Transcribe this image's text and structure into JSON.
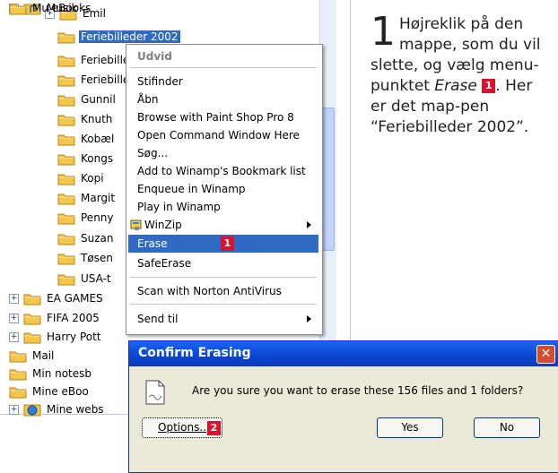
{
  "tree": {
    "items": [
      {
        "label": "Emil",
        "expander": "+"
      },
      {
        "label": "Feriebilleder 2002",
        "selected": true
      },
      {
        "label": "Feriebilleder"
      },
      {
        "label": "Feriebilleder"
      },
      {
        "label": "Gunnil"
      },
      {
        "label": "Knuth"
      },
      {
        "label": "Kobæl"
      },
      {
        "label": "Kongs"
      },
      {
        "label": "Kopi"
      },
      {
        "label": "Margit"
      },
      {
        "label": "Penny"
      },
      {
        "label": "Suzan"
      },
      {
        "label": "Tøsen"
      },
      {
        "label": "USA-t"
      },
      {
        "label": "EA GAMES",
        "expander": "+"
      },
      {
        "label": "FIFA 2005",
        "expander": "+"
      },
      {
        "label": "Harry Pott",
        "expander": "+"
      },
      {
        "label": "Mail"
      },
      {
        "label": "Min notesb"
      },
      {
        "label": "Mine eBoo"
      },
      {
        "label": "Mine webs",
        "expander": "+",
        "icon": "globe"
      },
      {
        "label": "Musik",
        "expander": "+",
        "icon": "music"
      },
      {
        "label": "Mu eBooks"
      }
    ]
  },
  "context_menu": {
    "header": "Udvid",
    "items": [
      "Stifinder",
      "Åbn",
      "Browse with Paint Shop Pro 8",
      "Open Command Window Here",
      "Søg...",
      "Add to Winamp's Bookmark list",
      "Enqueue in Winamp",
      "Play in Winamp",
      "WinZip",
      "Erase",
      "SafeErase",
      "Scan with Norton AntiVirus",
      "Send til"
    ],
    "highlighted": "Erase",
    "erase_badge": "1"
  },
  "instruction": {
    "number": "1",
    "text_before": "Højreklik på den mappe, som du vil slette, og vælg menu-punktet ",
    "emphasis": "Erase",
    "badge": "1",
    "text_after": ". Her er det map-pen “Feriebilleder 2002”."
  },
  "dialog": {
    "title": "Confirm Erasing",
    "message": "Are you sure you want to erase these 156 files and 1 folders?",
    "options_label": "Options..",
    "options_badge": "2",
    "yes_label": "Yes",
    "no_label": "No",
    "close_symbol": "✕"
  },
  "colors": {
    "selection": "#316ac5",
    "badge": "#d9132d",
    "dialog_bg": "#ece9d8",
    "title_bar": "#0a44cf",
    "folder": "#f3c64d"
  }
}
